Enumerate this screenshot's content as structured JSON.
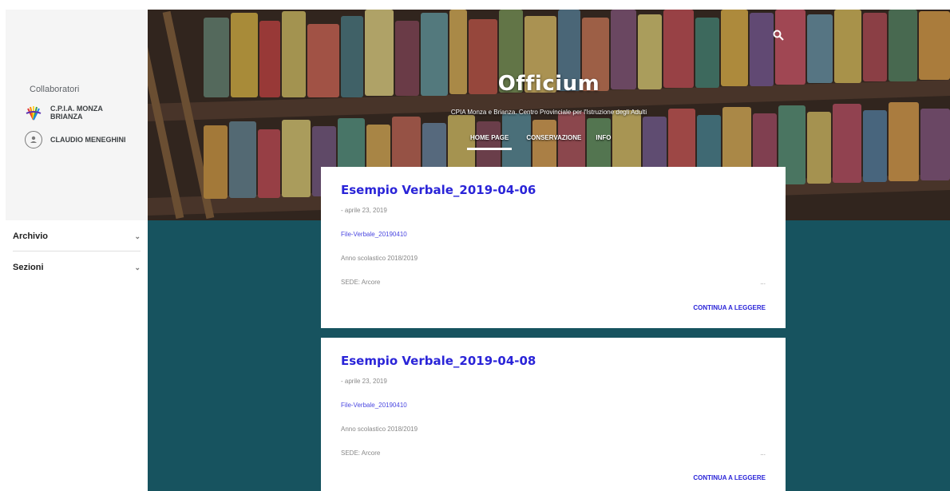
{
  "sidebar": {
    "contributors_title": "Collaboratori",
    "contributors": [
      {
        "name": "C.P.I.A. MONZA BRIANZA",
        "icon": "cpia-logo-icon"
      },
      {
        "name": "CLAUDIO MENEGHINI",
        "icon": "user-avatar-icon"
      }
    ],
    "sections": [
      {
        "label": "Archivio",
        "icon": "chevron-down-icon"
      },
      {
        "label": "Sezioni",
        "icon": "chevron-down-icon"
      }
    ]
  },
  "header": {
    "title": "Officium",
    "subtitle": "CPIA Monza e Brianza. Centro Provinciale per l'Istruzione degli Adulti",
    "search_icon": "search-icon",
    "nav": [
      {
        "label": "HOME PAGE",
        "active": true
      },
      {
        "label": "CONSERVAZIONE",
        "active": false
      },
      {
        "label": "INFO",
        "active": false
      }
    ]
  },
  "posts": [
    {
      "title": "Esempio Verbale_2019-04-06",
      "date": "- aprile 23, 2019",
      "link": "File-Verbale_20190410",
      "line1": "Anno scolastico 2018/2019",
      "line2": "SEDE: Arcore",
      "ellipsis": "...",
      "more": "CONTINUA A LEGGERE"
    },
    {
      "title": "Esempio Verbale_2019-04-08",
      "date": "- aprile 23, 2019",
      "link": "File-Verbale_20190410",
      "line1": "Anno scolastico 2018/2019",
      "line2": "SEDE: Arcore",
      "ellipsis": "...",
      "more": "CONTINUA A LEGGERE"
    }
  ],
  "colors": {
    "teal_background": "#17535f",
    "link_blue": "#2a24d8",
    "header_dark": "#3a2a22"
  }
}
